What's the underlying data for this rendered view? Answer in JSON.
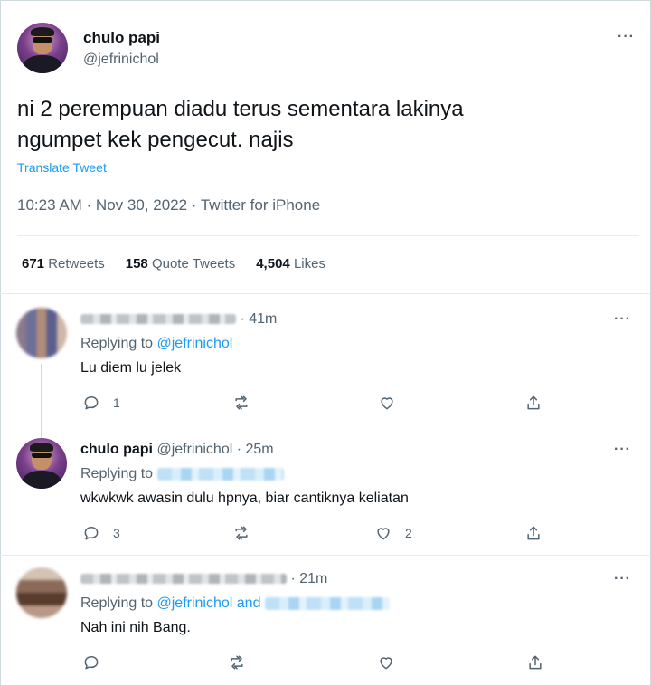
{
  "main_tweet": {
    "author_name": "chulo papi",
    "author_handle": "@jefrinichol",
    "text_line1": "ni 2 perempuan diadu terus sementara lakinya",
    "text_line2": "ngumpet kek pengecut. najis",
    "translate_label": "Translate Tweet",
    "timestamp": "10:23 AM · Nov 30, 2022 · Twitter for iPhone",
    "stats": {
      "retweets_count": "671",
      "retweets_label": "Retweets",
      "quotes_count": "158",
      "quotes_label": "Quote Tweets",
      "likes_count": "4,504",
      "likes_label": "Likes"
    },
    "more_label": "···"
  },
  "replies": [
    {
      "author_name": "",
      "author_handle": "",
      "time": "· 41m",
      "replying_prefix": "Replying to",
      "replying_to": "@jefrinichol",
      "text": "Lu diem lu jelek",
      "reply_count": "1",
      "retweet_count": "",
      "like_count": "",
      "avatar_icon": "blurred-avatar"
    },
    {
      "author_name": "chulo papi",
      "author_handle": "@jefrinichol",
      "time": "· 25m",
      "replying_prefix": "Replying to",
      "replying_to": "",
      "text": "wkwkwk awasin dulu hpnya, biar cantiknya keliatan",
      "reply_count": "3",
      "retweet_count": "",
      "like_count": "2",
      "avatar_icon": "profile-avatar"
    },
    {
      "author_name": "",
      "author_handle": "",
      "time": "· 21m",
      "replying_prefix": "Replying to",
      "replying_to": "@jefrinichol",
      "replying_and": "and",
      "text": "Nah ini nih Bang.",
      "reply_count": "",
      "retweet_count": "",
      "like_count": "",
      "avatar_icon": "blurred-avatar"
    }
  ],
  "colors": {
    "accent": "#1d9bf0",
    "text_primary": "#0f1419",
    "text_secondary": "#536471",
    "divider": "#e6ecf0"
  }
}
